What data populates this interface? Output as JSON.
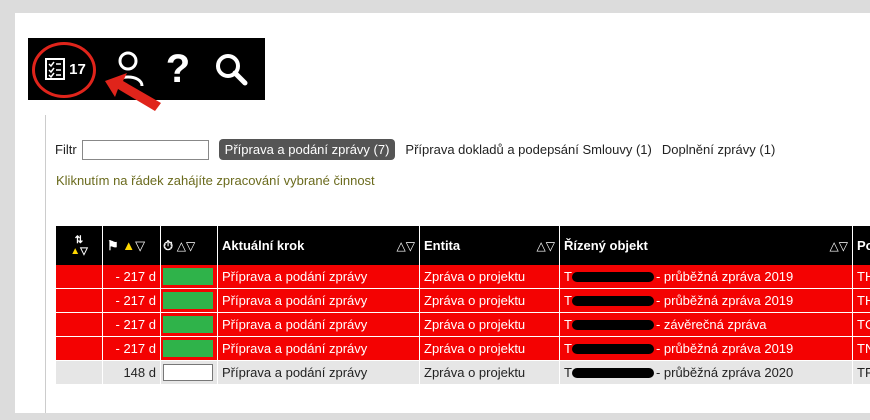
{
  "toolbar": {
    "task_count": "17",
    "items": [
      "tasks-icon",
      "user-icon",
      "help-icon",
      "search-icon"
    ],
    "help_glyph": "?"
  },
  "filter": {
    "label": "Filtr",
    "value": "",
    "tabs": [
      {
        "label": "Příprava a podání zprávy (7)",
        "active": true
      },
      {
        "label": "Příprava dokladů a podepsání Smlouvy (1)",
        "active": false
      },
      {
        "label": "Doplnění zprávy (1)",
        "active": false
      }
    ]
  },
  "hint": "Kliknutím na řádek zahájíte zpracování vybrané činnost",
  "table": {
    "headers": [
      "Aktuální krok",
      "Entita",
      "Řízený objekt",
      "Po"
    ],
    "rows": [
      {
        "days": "- 217 d",
        "step": "Příprava a podání zprávy",
        "entity": "Zpráva o projektu",
        "object_prefix": "T",
        "object_suffix": "- průběžná zpráva 2019",
        "tail": "TH",
        "status": "red",
        "bar": "green"
      },
      {
        "days": "- 217 d",
        "step": "Příprava a podání zprávy",
        "entity": "Zpráva o projektu",
        "object_prefix": "T",
        "object_suffix": "- průběžná zpráva 2019",
        "tail": "TH",
        "status": "red",
        "bar": "green"
      },
      {
        "days": "- 217 d",
        "step": "Příprava a podání zprávy",
        "entity": "Zpráva o projektu",
        "object_prefix": "T",
        "object_suffix": "- závěrečná zpráva",
        "tail": "TC",
        "status": "red",
        "bar": "green"
      },
      {
        "days": "- 217 d",
        "step": "Příprava a podání zprávy",
        "entity": "Zpráva o projektu",
        "object_prefix": "T",
        "object_suffix": "- průběžná zpráva 2019",
        "tail": "TN",
        "status": "red",
        "bar": "green"
      },
      {
        "days": "148 d",
        "step": "Příprava a podání zprávy",
        "entity": "Zpráva o projektu",
        "object_prefix": "T",
        "object_suffix": "- průběžná zpráva 2020",
        "tail": "TF",
        "status": "gray",
        "bar": "white"
      }
    ]
  },
  "colors": {
    "row_red": "#f40202",
    "row_gray": "#e6e6e6",
    "progress_green": "#2fb34a",
    "highlight_circle": "#e0241b"
  }
}
